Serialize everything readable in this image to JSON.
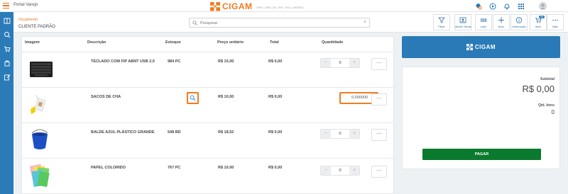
{
  "app": {
    "title": "Portal Varejo"
  },
  "brand": {
    "name": "CIGAM",
    "tagline": "ERP | CRM | BI | RH | PDV | MOBILE"
  },
  "header": {
    "section": "Orçamento",
    "customer": "CLIENTE PADRÃO"
  },
  "search": {
    "placeholder": "Pesquisar"
  },
  "toolbar": [
    {
      "label": "Filtrar",
      "icon": "filter-icon"
    },
    {
      "label": "Alterar Cliente",
      "icon": "change-customer-icon"
    },
    {
      "label": "Leitor",
      "icon": "barcode-icon"
    },
    {
      "label": "Novo",
      "icon": "plus-icon"
    },
    {
      "label": "Observação",
      "icon": "info-icon"
    },
    {
      "label": "Itens",
      "icon": "cart-icon",
      "badge": "00"
    },
    {
      "label": "Mais",
      "icon": "more-icon"
    }
  ],
  "table": {
    "columns": [
      "Imagem",
      "Descrição",
      "Estoque",
      "Preço unitário",
      "Total",
      "Quantidade"
    ],
    "rows": [
      {
        "description": "TECLADO COM FIP ABNT USB 2.0",
        "stock": "984 PC",
        "unit_price": "R$ 10,00",
        "total": "R$ 0,00",
        "quantity": "0",
        "image": "keyboard"
      },
      {
        "description": "SACOS DE CHA",
        "stock": "",
        "unit_price": "R$ 10,00",
        "total": "R$ 0,00",
        "quantity": "0,000000",
        "image": "tea-bags"
      },
      {
        "description": "BALDE AZUL PLÁSTICO GRANDE",
        "stock": "548 BD",
        "unit_price": "R$ 18,52",
        "total": "R$ 0,00",
        "quantity": "0",
        "image": "blue-bucket"
      },
      {
        "description": "PAPEL COLORIDO",
        "stock": "767 PC",
        "unit_price": "R$ 10,00",
        "total": "R$ 0,00",
        "quantity": "0",
        "image": "colored-paper"
      }
    ],
    "more_label": "···"
  },
  "summary": {
    "subtotal_label": "Subtotal",
    "subtotal_value": "R$ 0,00",
    "qty_label": "Qtd. itens",
    "qty_value": "0",
    "pay_label": "PAGAR"
  },
  "colors": {
    "accent": "#ef7d22",
    "primary": "#2b7bb9",
    "pay": "#0a7a2e"
  }
}
